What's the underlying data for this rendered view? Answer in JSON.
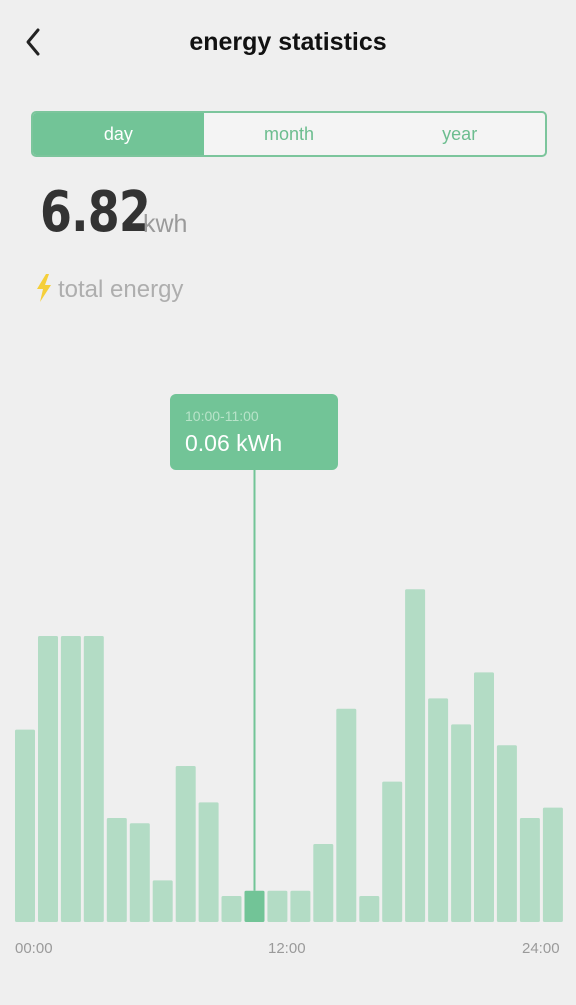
{
  "header": {
    "title": "energy statistics"
  },
  "tabs": [
    {
      "label": "day",
      "active": true
    },
    {
      "label": "month",
      "active": false
    },
    {
      "label": "year",
      "active": false
    }
  ],
  "summary": {
    "value": "6.82",
    "unit": "kwh",
    "label": "total energy"
  },
  "tooltip": {
    "range": "10:00-11:00",
    "value": "0.06 kWh"
  },
  "colors": {
    "accent": "#72c497",
    "bar": "#b3dcc5",
    "bar_selected": "#72c497",
    "bolt": "#f5cf3a"
  },
  "chart_data": {
    "type": "bar",
    "x_tick_labels": [
      "00:00",
      "12:00",
      "24:00"
    ],
    "categories": [
      "00:00-01:00",
      "01:00-02:00",
      "02:00-03:00",
      "03:00-04:00",
      "04:00-05:00",
      "05:00-06:00",
      "06:00-07:00",
      "07:00-08:00",
      "08:00-09:00",
      "09:00-10:00",
      "10:00-11:00",
      "11:00-12:00",
      "12:00-13:00",
      "13:00-14:00",
      "14:00-15:00",
      "15:00-16:00",
      "16:00-17:00",
      "17:00-18:00",
      "18:00-19:00",
      "19:00-20:00",
      "20:00-21:00",
      "21:00-22:00",
      "22:00-23:00",
      "23:00-24:00"
    ],
    "relative_values": [
      0.37,
      0.55,
      0.55,
      0.55,
      0.2,
      0.19,
      0.08,
      0.3,
      0.23,
      0.05,
      0.06,
      0.06,
      0.06,
      0.15,
      0.41,
      0.05,
      0.27,
      0.64,
      0.43,
      0.38,
      0.48,
      0.34,
      0.2,
      0.22
    ],
    "selected_index": 10,
    "selected_value_kwh": 0.06
  }
}
